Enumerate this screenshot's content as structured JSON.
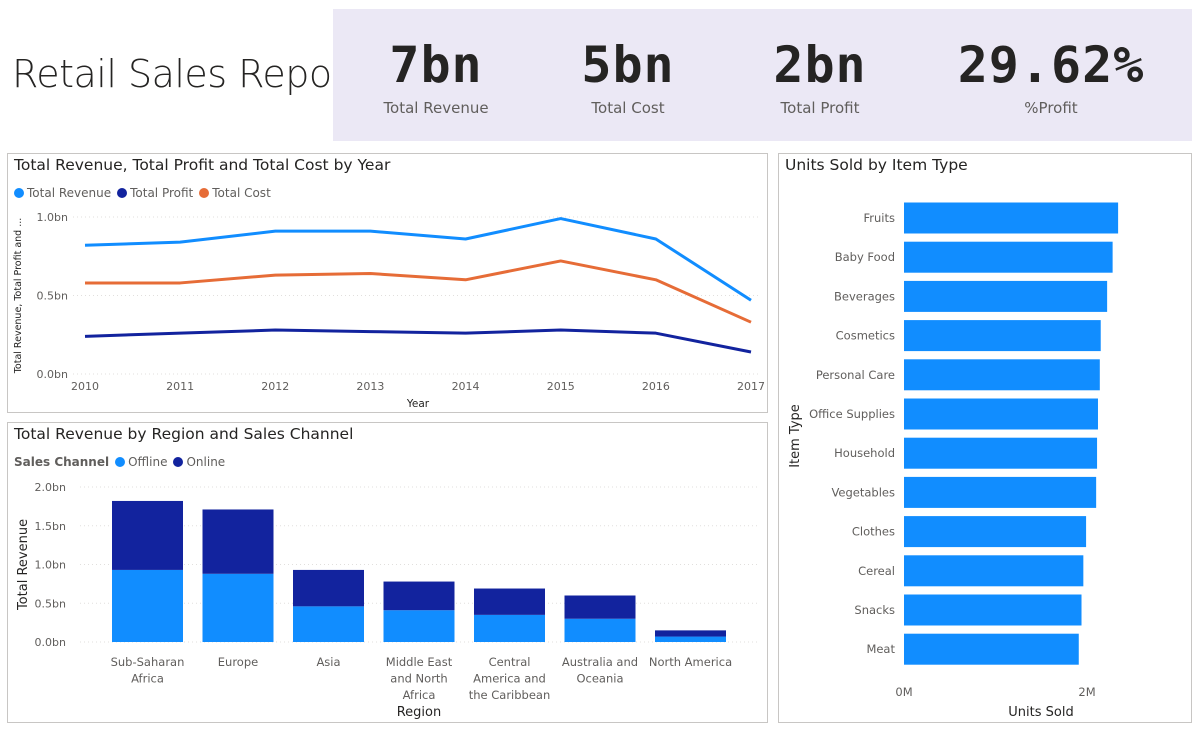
{
  "report": {
    "title": "Retail Sales Report"
  },
  "kpis": [
    {
      "value": "7bn",
      "label": "Total Revenue"
    },
    {
      "value": "5bn",
      "label": "Total Cost"
    },
    {
      "value": "2bn",
      "label": "Total Profit"
    },
    {
      "value": "29.62%",
      "label": "%Profit"
    }
  ],
  "colors": {
    "revenue": "#118dff",
    "profit": "#12239e",
    "cost": "#e66c37",
    "offline": "#118dff",
    "online": "#12239e",
    "bar": "#118dff",
    "kpi_band": "#ebe8f5"
  },
  "chart_data": [
    {
      "type": "line",
      "title": "Total Revenue, Total Profit and Total Cost by Year",
      "xlabel": "Year",
      "ylabel": "Total Revenue, Total Profit and ...",
      "x": [
        "2010",
        "2011",
        "2012",
        "2013",
        "2014",
        "2015",
        "2016",
        "2017"
      ],
      "series": [
        {
          "name": "Total Revenue",
          "values": [
            0.82,
            0.84,
            0.91,
            0.91,
            0.86,
            0.99,
            0.86,
            0.47
          ]
        },
        {
          "name": "Total Profit",
          "values": [
            0.24,
            0.26,
            0.28,
            0.27,
            0.26,
            0.28,
            0.26,
            0.14
          ]
        },
        {
          "name": "Total Cost",
          "values": [
            0.58,
            0.58,
            0.63,
            0.64,
            0.6,
            0.72,
            0.6,
            0.33
          ]
        }
      ],
      "ylim": [
        0,
        1.0
      ],
      "yticks": [
        "0.0bn",
        "0.5bn",
        "1.0bn"
      ],
      "legend": "top-left",
      "grid": true
    },
    {
      "type": "bar",
      "stacked": true,
      "title": "Total Revenue by Region and Sales Channel",
      "legend_title": "Sales Channel",
      "xlabel": "Region",
      "ylabel": "Total Revenue",
      "categories": [
        "Sub-Saharan Africa",
        "Europe",
        "Asia",
        "Middle East and North Africa",
        "Central America and the Caribbean",
        "Australia and Oceania",
        "North America"
      ],
      "category_lines": [
        [
          "Sub-Saharan",
          "Africa"
        ],
        [
          "Europe"
        ],
        [
          "Asia"
        ],
        [
          "Middle East",
          "and North",
          "Africa"
        ],
        [
          "Central",
          "America and",
          "the Caribbean"
        ],
        [
          "Australia and",
          "Oceania"
        ],
        [
          "North America"
        ]
      ],
      "series": [
        {
          "name": "Offline",
          "values": [
            0.93,
            0.88,
            0.46,
            0.41,
            0.35,
            0.3,
            0.07
          ]
        },
        {
          "name": "Online",
          "values": [
            0.89,
            0.83,
            0.47,
            0.37,
            0.34,
            0.3,
            0.08
          ]
        }
      ],
      "ylim": [
        0,
        2.0
      ],
      "yticks": [
        "0.0bn",
        "0.5bn",
        "1.0bn",
        "1.5bn",
        "2.0bn"
      ],
      "legend": "top-left",
      "grid": true
    },
    {
      "type": "bar",
      "orientation": "horizontal",
      "title": "Units Sold by Item Type",
      "xlabel": "Units Sold",
      "ylabel": "Item Type",
      "categories": [
        "Fruits",
        "Baby Food",
        "Beverages",
        "Cosmetics",
        "Personal Care",
        "Office Supplies",
        "Household",
        "Vegetables",
        "Clothes",
        "Cereal",
        "Snacks",
        "Meat"
      ],
      "values": [
        2.34,
        2.28,
        2.22,
        2.15,
        2.14,
        2.12,
        2.11,
        2.1,
        1.99,
        1.96,
        1.94,
        1.91
      ],
      "value_unit": "M",
      "xlim": [
        0,
        2
      ],
      "xticks": [
        "0M",
        "2M"
      ]
    }
  ]
}
